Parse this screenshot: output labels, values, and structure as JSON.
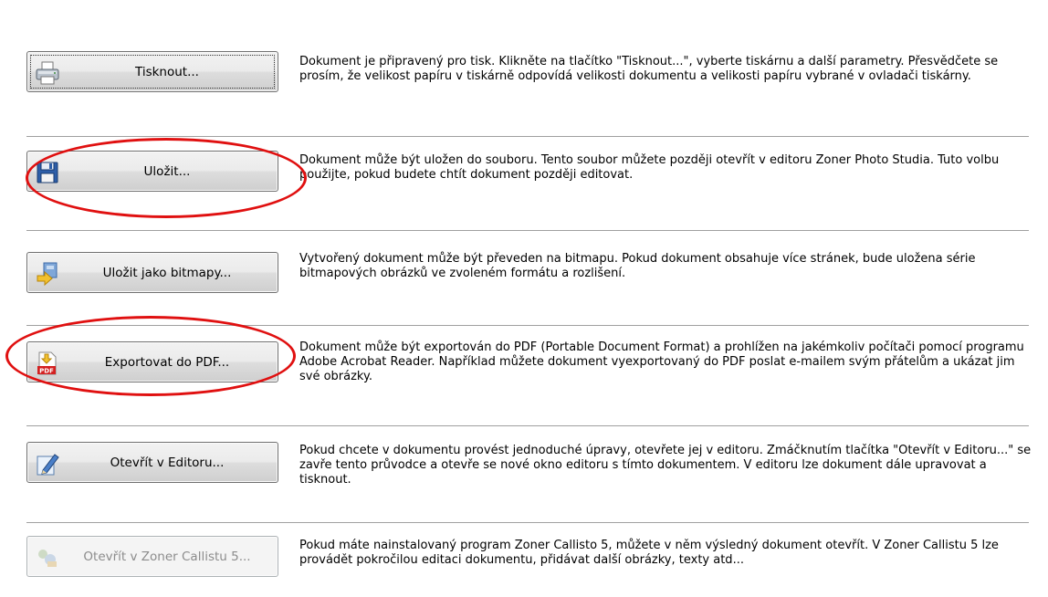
{
  "rows": [
    {
      "button": "Tisknout...",
      "icon": "printer-icon",
      "description": "Dokument je připravený pro tisk. Klikněte na tlačítko \"Tisknout...\", vyberte tiskárnu a další parametry. Přesvědčete se prosím, že velikost papíru v tiskárně odpovídá velikosti dokumentu a velikosti papíru vybrané v ovladači tiskárny."
    },
    {
      "button": "Uložit...",
      "icon": "floppy-disk-icon",
      "description": "Dokument může být uložen do souboru. Tento soubor můžete později otevřít v editoru Zoner Photo Studia. Tuto volbu použijte, pokud budete chtít dokument později editovat."
    },
    {
      "button": "Uložit jako bitmapy...",
      "icon": "bitmap-export-icon",
      "description": "Vytvořený dokument může být převeden na bitmapu. Pokud dokument obsahuje více stránek, bude uložena série bitmapových obrázků ve zvoleném formátu a rozlišení."
    },
    {
      "button": "Exportovat do PDF...",
      "icon": "pdf-export-icon",
      "icon_badge": "PDF",
      "description": "Dokument může být exportován do PDF (Portable Document Format) a prohlížen na jakémkoliv počítači pomocí programu Adobe Acrobat Reader. Například můžete dokument vyexportovaný do PDF poslat e-mailem svým přátelům a ukázat jim své obrázky."
    },
    {
      "button": "Otevřít v Editoru...",
      "icon": "edit-pencil-icon",
      "description": "Pokud chcete v dokumentu provést jednoduché úpravy, otevřete jej v editoru. Zmáčknutím tlačítka \"Otevřít v Editoru...\" se zavře tento průvodce a otevře se nové okno editoru s tímto dokumentem. V editoru lze dokument dále upravovat a tisknout."
    },
    {
      "button": "Otevřít v Zoner Callistu 5...",
      "icon": "callisto-icon",
      "disabled": true,
      "description": "Pokud máte nainstalovaný program Zoner Callisto 5, můžete v něm výsledný dokument otevřít. V Zoner Callistu 5 lze provádět pokročilou editaci dokumentu, přidávat další obrázky, texty atd..."
    }
  ],
  "colors": {
    "annotation": "#e01010",
    "separator": "#a0a0a0",
    "disabled_text": "#8c8c8c"
  }
}
